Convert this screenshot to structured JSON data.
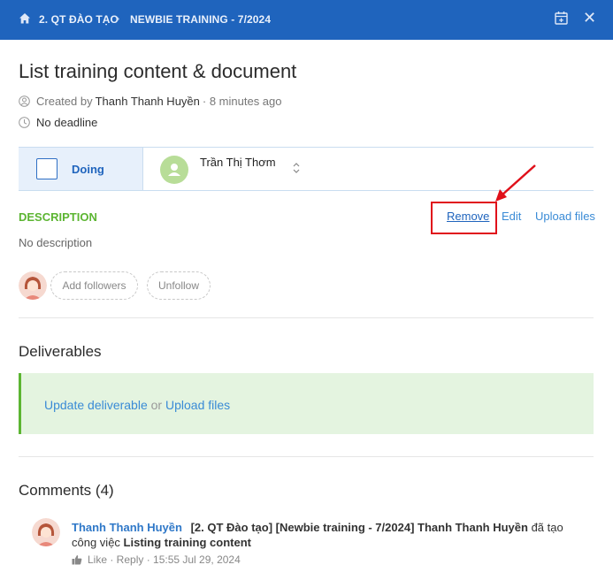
{
  "breadcrumb": {
    "project": "2. QT ĐÀO TẠO",
    "separator": "›",
    "list": "NEWBIE TRAINING - 7/2024"
  },
  "task": {
    "title": "List training content & document",
    "created_prefix": "Created by",
    "creator": "Thanh Thanh Huyền",
    "created_time": "· 8 minutes ago",
    "deadline": "No deadline"
  },
  "status": {
    "label": "Doing",
    "assignee": "Trần Thị Thơm"
  },
  "description": {
    "label": "DESCRIPTION",
    "remove": "Remove",
    "edit": "Edit",
    "upload": "Upload files",
    "text": "No description"
  },
  "followers": {
    "add": "Add followers",
    "unfollow": "Unfollow"
  },
  "deliverables": {
    "title": "Deliverables",
    "update_link": "Update deliverable",
    "or": "or",
    "upload_link": "Upload files"
  },
  "comments": {
    "title": "Comments (4)",
    "items": [
      {
        "author": "Thanh Thanh Huyền",
        "text_prefix": "[2. QT Đào tạo] [Newbie training - 7/2024] Thanh Thanh Huyền",
        "text_mid": "đã tạo công việc",
        "text_bold": "Listing training content",
        "meta": "Like · Reply · 15:55 Jul 29, 2024"
      }
    ]
  },
  "colors": {
    "header_bg": "#1f64bd",
    "accent_green": "#5cb532",
    "link_blue": "#3a8bd6",
    "annotation_red": "#e0101a"
  }
}
